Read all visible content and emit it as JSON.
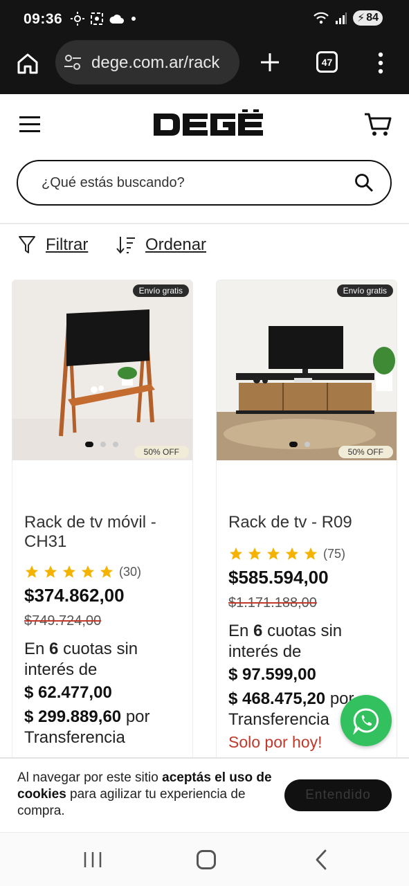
{
  "status_bar": {
    "time": "09:36",
    "battery": "84"
  },
  "browser": {
    "url": "dege.com.ar/rack",
    "tab_count": "47"
  },
  "header": {
    "logo_text": "DEGË",
    "search_placeholder": "¿Qué estás buscando?"
  },
  "toolbar": {
    "filter_label": "Filtrar",
    "order_label": "Ordenar"
  },
  "products": [
    {
      "title": "Rack de tv móvil - CH31",
      "shipping_badge": "Envío gratis",
      "discount_badge": "50% OFF",
      "stars": 5,
      "rating_count": "(30)",
      "price": "$374.862,00",
      "old_price": "$749.724,00",
      "installments_prefix": "En",
      "installments_number": "6",
      "installments_suffix": "cuotas sin interés de",
      "installment_amount": "$ 62.477,00",
      "transfer_price": "$ 299.889,60",
      "transfer_suffix": "por Transferencia"
    },
    {
      "title": "Rack de tv - R09",
      "shipping_badge": "Envío gratis",
      "discount_badge": "50% OFF",
      "stars": 5,
      "rating_count": "(75)",
      "price": "$585.594,00",
      "old_price": "$1.171.188,00",
      "installments_prefix": "En",
      "installments_number": "6",
      "installments_suffix": "cuotas sin interés de",
      "installment_amount": "$ 97.599,00",
      "transfer_price": "$ 468.475,20",
      "transfer_suffix": "por Transferencia",
      "promo": "Solo por hoy!"
    }
  ],
  "cookie": {
    "text_1": "Al navegar por este sitio ",
    "bold_1": "aceptás el uso de cookies",
    "text_2": " para agilizar tu experiencia de compra.",
    "button": "Entendido"
  },
  "colors": {
    "accent": "#111111",
    "star": "#f5b301",
    "whatsapp": "#33c15f",
    "sale": "#c0392b"
  }
}
